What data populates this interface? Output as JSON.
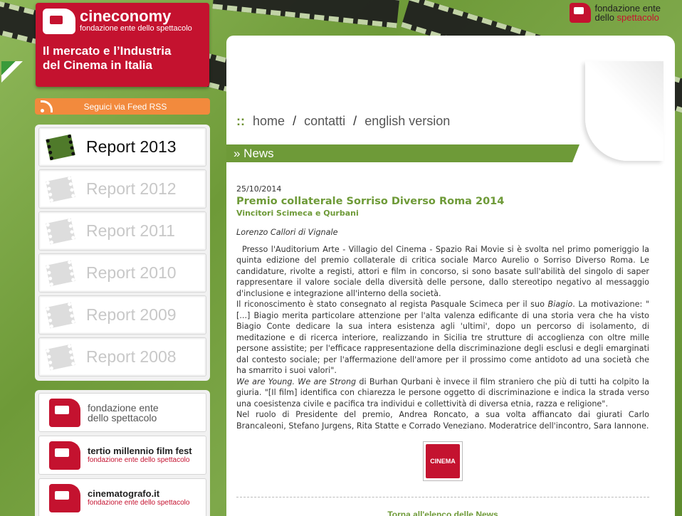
{
  "brand": {
    "name": "cineconomy",
    "sub": "fondazione ente dello spettacolo",
    "tagline_1": "Il mercato e l’Industria",
    "tagline_2": "del Cinema in Italia"
  },
  "top_logo": {
    "line1": "fondazione ente",
    "line2a": "dello ",
    "line2b": "spettacolo"
  },
  "rss": {
    "label": "Seguici via Feed RSS",
    "icon": "rss-icon"
  },
  "reports": [
    {
      "label": "Report 2013",
      "active": true
    },
    {
      "label": "Report 2012",
      "active": false
    },
    {
      "label": "Report 2011",
      "active": false
    },
    {
      "label": "Report 2010",
      "active": false
    },
    {
      "label": "Report 2009",
      "active": false
    },
    {
      "label": "Report 2008",
      "active": false
    }
  ],
  "partners": [
    {
      "line1": "fondazione ente",
      "line2": "dello spettacolo"
    },
    {
      "line1": "tertio millennio film fest",
      "line2": "fondazione ente dello spettacolo"
    },
    {
      "line1": "cinematografo.it",
      "line2": "fondazione ente dello spettacolo"
    }
  ],
  "nav": {
    "prefix": "::",
    "home": "home",
    "contatti": "contatti",
    "english": "english version"
  },
  "section": {
    "title": "» News"
  },
  "article": {
    "date": "25/10/2014",
    "title": "Premio collaterale Sorriso Diverso Roma 2014",
    "subtitle": "Vincitori Scimeca e Qurbani",
    "author": "Lorenzo Callori di Vignale",
    "p1": "Presso l'Auditorium Arte - Villagio del Cinema - Spazio Rai Movie si è svolta nel primo pomeriggio la quinta edizione del premio collaterale di critica sociale Marco Aurelio o Sorriso Diverso Roma. Le candidature, rivolte a registi, attori e film in concorso, si sono basate sull'abilità del singolo di saper rappresentare il valore sociale della diversità delle persone, dallo stereotipo negativo al messaggio d'inclusione e integrazione all'interno della società.",
    "p2a": "Il riconoscimento è stato consegnato al regista Pasquale Scimeca per il suo ",
    "p2_film": "Biagio",
    "p2b": ". La motivazione: \"[...] Biagio merita particolare attenzione per l'alta valenza edificante di una storia vera che ha visto Biagio Conte dedicare la sua intera esistenza agli 'ultimi', dopo un percorso di isolamento, di meditazione e di ricerca interiore, realizzando in Sicilia tre strutture di accoglienza con oltre mille persone assistite; per l'efficace rappresentazione della discriminazione degli esclusi e degli emarginati dal contesto sociale; per l'affermazione dell'amore per il prossimo come antidoto ad una società che ha smarrito i suoi valori\".",
    "p3_film": "We are Young. We are Strong",
    "p3a": " di Burhan Qurbani è invece il film straniero che più di tutti ha colpito la giuria. \"[Il film] identifica con chiarezza le persone oggetto di discriminazione e indica la strada verso una coesistenza civile e pacifica tra individui e collettività di diversa etnia, razza e religione\".",
    "p4": "Nel ruolo di Presidente del premio, Andrea Roncato, a sua volta affiancato dai giurati Carlo Brancaleoni, Stefano Jurgens, Rita Statte e Corrado Veneziano. Moderatrice dell'incontro, Sara Iannone.",
    "logo_text": "CINEMA",
    "back_link": "Torna all'elenco delle News"
  },
  "colors": {
    "accent": "#6e9a38",
    "brand_red": "#c4122f",
    "rss_orange": "#f28a3d"
  }
}
